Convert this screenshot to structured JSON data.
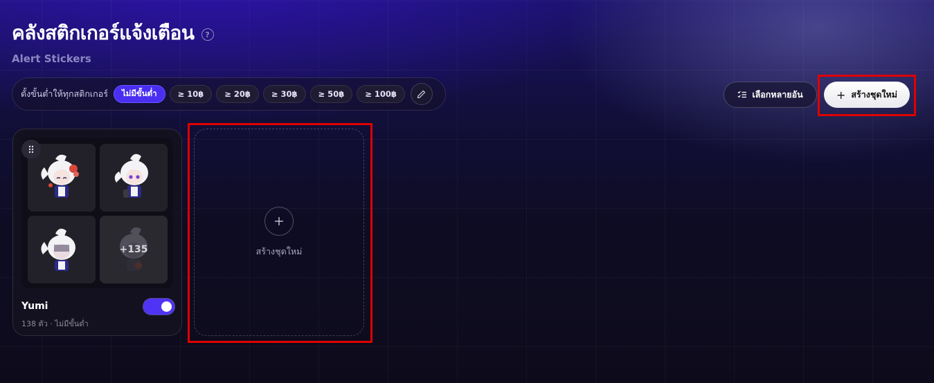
{
  "header": {
    "title": "คลังสติกเกอร์แจ้งเตือน",
    "subtitle": "Alert Stickers",
    "help_icon": "question-circle-icon"
  },
  "filter": {
    "label": "ตั้งขั้นต่ำให้ทุกสติกเกอร์",
    "chips": [
      {
        "label": "ไม่มีขั้นต่ำ",
        "active": true
      },
      {
        "label": "≥ 10฿",
        "active": false
      },
      {
        "label": "≥ 20฿",
        "active": false
      },
      {
        "label": "≥ 30฿",
        "active": false
      },
      {
        "label": "≥ 50฿",
        "active": false
      },
      {
        "label": "≥ 100฿",
        "active": false
      }
    ],
    "edit_icon": "pencil-icon"
  },
  "toolbar": {
    "multi_select_label": "เลือกหลายอัน",
    "new_set_label": "สร้างชุดใหม่"
  },
  "sticker_set": {
    "name": "Yumi",
    "meta": "138 ตัว · ไม่มีขั้นต่ำ",
    "more_count": "+135",
    "enabled": true
  },
  "new_set_card": {
    "label": "สร้างชุดใหม่"
  },
  "colors": {
    "accent": "#4f34f5",
    "highlight_box": "#e00000"
  }
}
